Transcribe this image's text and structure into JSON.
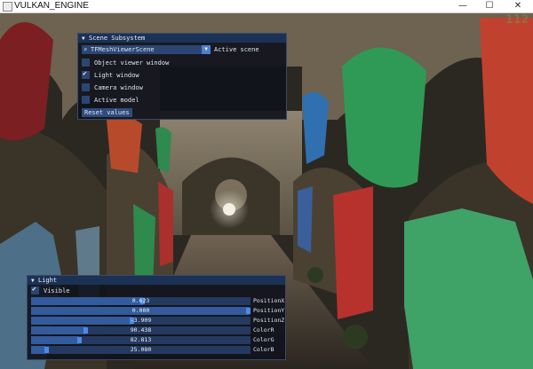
{
  "window": {
    "title": "VULKAN_ENGINE",
    "minimize": "—",
    "maximize": "☐",
    "close": "✕"
  },
  "overlay": {
    "fps": "112"
  },
  "scene_panel": {
    "header": "Scene Subsystem",
    "combo": {
      "value": "TFMeshViewerScene",
      "label": "Active scene"
    },
    "checkboxes": [
      {
        "label": "Object viewer window",
        "checked": false
      },
      {
        "label": "Light window",
        "checked": true
      },
      {
        "label": "Camera window",
        "checked": false
      },
      {
        "label": "Active model",
        "checked": false
      }
    ],
    "reset_label": "Reset values"
  },
  "light_panel": {
    "header": "Light",
    "visible": {
      "label": "Visible",
      "checked": true
    },
    "sliders": [
      {
        "value": "0.623",
        "label": "PositionX",
        "fraction": 0.51
      },
      {
        "value": "0.000",
        "label": "PositionY",
        "fraction": 0.99
      },
      {
        "value": "-3.909",
        "label": "PositionZ",
        "fraction": 0.46
      },
      {
        "value": "90.438",
        "label": "ColorR",
        "fraction": 0.25
      },
      {
        "value": "82.813",
        "label": "ColorG",
        "fraction": 0.22
      },
      {
        "value": "25.080",
        "label": "ColorB",
        "fraction": 0.07
      }
    ]
  }
}
